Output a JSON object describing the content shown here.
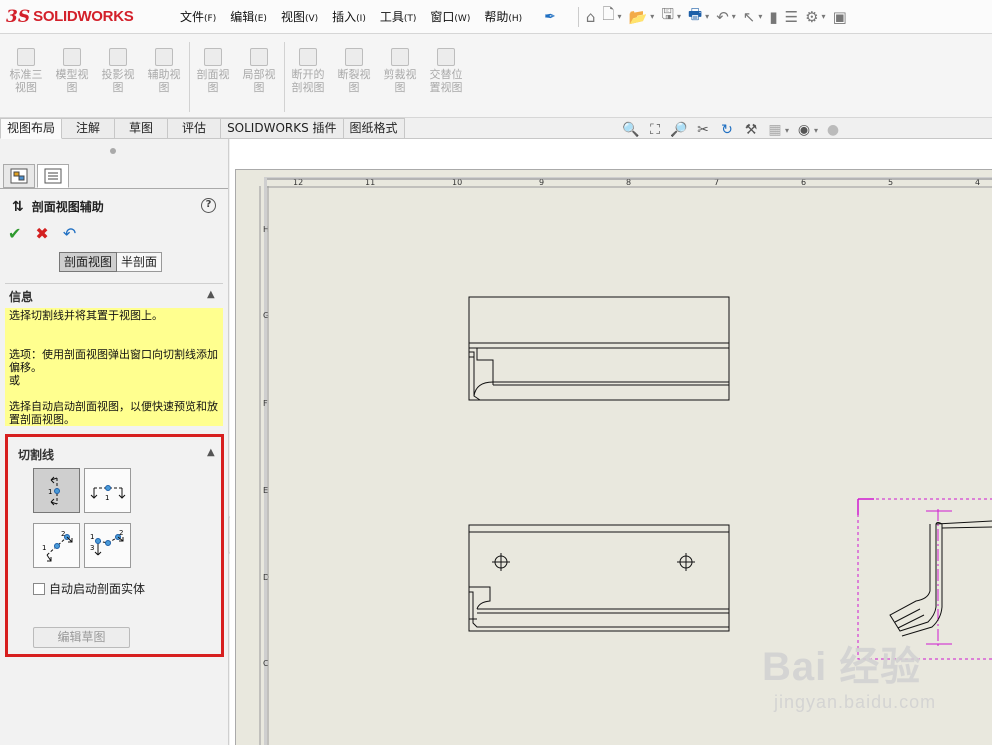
{
  "app": {
    "logo_ds": "3S",
    "logo_name": "SOLIDWORKS",
    "menus": [
      {
        "label": "文件",
        "key": "(F)"
      },
      {
        "label": "编辑",
        "key": "(E)"
      },
      {
        "label": "视图",
        "key": "(V)"
      },
      {
        "label": "插入",
        "key": "(I)"
      },
      {
        "label": "工具",
        "key": "(T)"
      },
      {
        "label": "窗口",
        "key": "(W)"
      },
      {
        "label": "帮助",
        "key": "(H)"
      }
    ],
    "pin_icon": "pin-icon"
  },
  "commands": [
    {
      "label": "标准三\n视图",
      "icon": "standard-3-view-icon"
    },
    {
      "label": "模型视\n图",
      "icon": "model-view-icon"
    },
    {
      "label": "投影视\n图",
      "icon": "projected-view-icon"
    },
    {
      "label": "辅助视\n图",
      "icon": "auxiliary-view-icon"
    },
    {
      "label": "剖面视\n图",
      "icon": "section-view-icon"
    },
    {
      "label": "局部视\n图",
      "icon": "detail-view-icon"
    },
    {
      "label": "断开的\n剖视图",
      "icon": "broken-out-section-icon"
    },
    {
      "label": "断裂视\n图",
      "icon": "break-view-icon"
    },
    {
      "label": "剪裁视\n图",
      "icon": "crop-view-icon"
    },
    {
      "label": "交替位\n置视图",
      "icon": "alternate-position-view-icon"
    }
  ],
  "tabs": [
    "视图布局",
    "注解",
    "草图",
    "评估",
    "SOLIDWORKS 插件",
    "图纸格式"
  ],
  "panel": {
    "title": "剖面视图辅助",
    "help": "?",
    "segments": [
      "剖面视图",
      "半剖面"
    ],
    "info_header": "信息",
    "info_text": "选择切割线并将其置于视图上。\n\n\n选项：使用剖面视图弹出窗口向切割线添加偏移。\n或\n\n选择自动启动剖面视图，以便快速预览和放置剖面视图。",
    "cutline_header": "切割线",
    "checkbox_label": "自动启动剖面实体",
    "edit_sketch": "编辑草图"
  },
  "sheet": {
    "col_zones": [
      "12",
      "11",
      "10",
      "9",
      "8",
      "7",
      "6",
      "5",
      "4"
    ],
    "row_zones": [
      "H",
      "G",
      "F",
      "E",
      "D",
      "C"
    ]
  },
  "watermark": {
    "line1": "Bai 经验",
    "line2": "jingyan.baidu.com"
  }
}
